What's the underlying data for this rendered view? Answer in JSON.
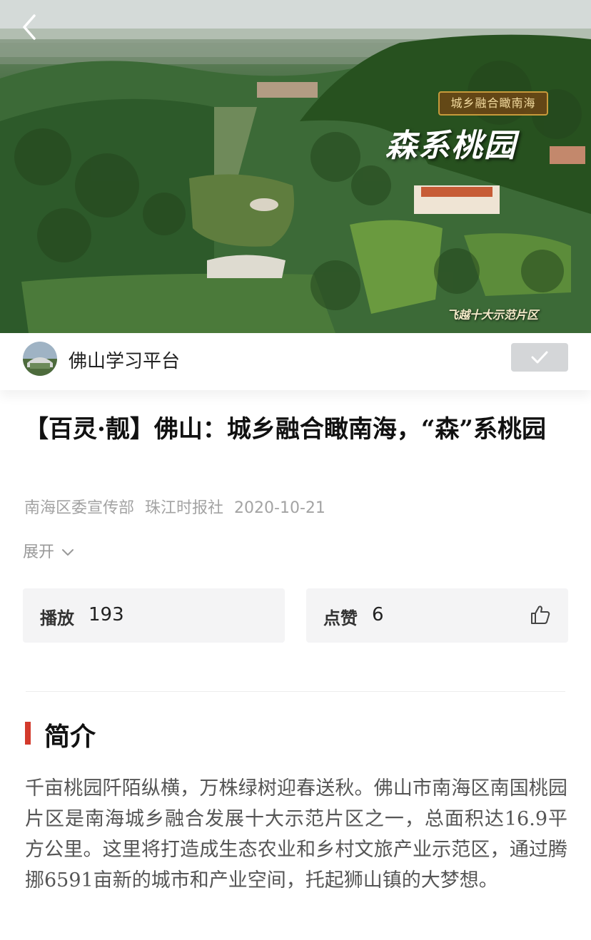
{
  "video": {
    "badge_text": "城乡融合瞰南海",
    "calligraphy_text": "森系桃园",
    "sub_caption": "飞越十大示范片区",
    "back_icon": "chevron-left-icon"
  },
  "channel": {
    "name": "佛山学习平台",
    "follow_icon": "check-icon"
  },
  "article": {
    "title": "【百灵·靓】佛山：城乡融合瞰南海，“森”系桃园",
    "meta": {
      "sources": [
        "南海区委宣传部",
        "珠江时报社"
      ],
      "date": "2020-10-21"
    },
    "expand_label": "展开"
  },
  "stats": {
    "play_label": "播放",
    "play_count": "193",
    "like_label": "点赞",
    "like_count": "6"
  },
  "intro": {
    "heading": "简介",
    "body": "千亩桃园阡陌纵横，万株绿树迎春送秋。佛山市南海区南国桃园片区是南海城乡融合发展十大示范片区之一，总面积达16.9平方公里。这里将打造成生态农业和乡村文旅产业示范区，通过腾挪6591亩新的城市和产业空间，托起狮山镇的大梦想。"
  },
  "colors": {
    "accent_red": "#d33a2c",
    "stat_bg": "#f4f4f5",
    "follow_bg": "#d4d6d8",
    "meta_gray": "#a3a3a3"
  }
}
